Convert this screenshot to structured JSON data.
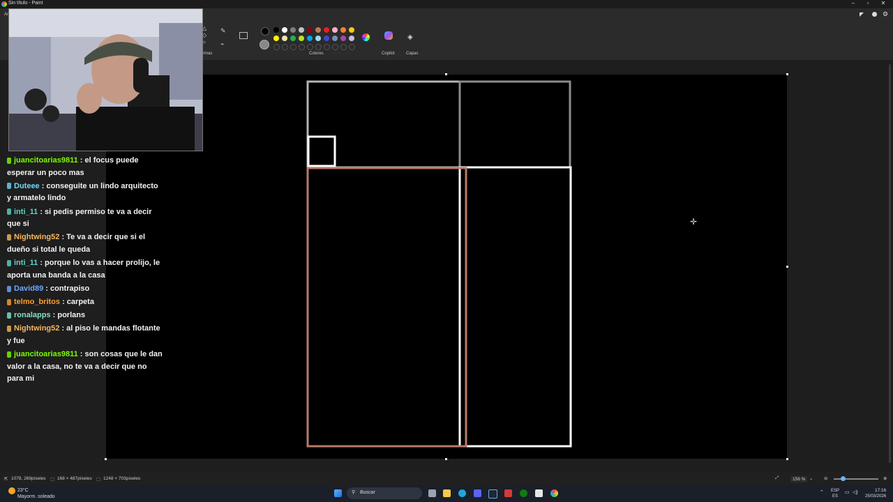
{
  "window": {
    "title": "Sin título - Paint"
  },
  "ribbon": {
    "groups": [
      "Formas",
      "Colores",
      "Copilot",
      "Capas"
    ],
    "left_cut_label": "Ar",
    "colors": [
      "#000000",
      "#ffffff",
      "#7f7f7f",
      "#c3c3c3",
      "#880015",
      "#b97a57",
      "#ed1c24",
      "#ffaec9",
      "#ff7f27",
      "#ffc90e",
      "#fff200",
      "#efe4b0",
      "#22b14c",
      "#b5e61d",
      "#00a2e8",
      "#99d9ea",
      "#3f48cc",
      "#7092be",
      "#a349a4",
      "#c8bfe7"
    ]
  },
  "chat": {
    "messages": [
      {
        "user": "juancitoarias9811",
        "user_color": "#7cfc00",
        "text": ": el focus puede esperar un poco mas"
      },
      {
        "user": "Duteee",
        "user_color": "#6fd6ff",
        "text": ": conseguite un lindo arquitecto y armatelo lindo"
      },
      {
        "user": "inti_11",
        "user_color": "#5fd3c6",
        "text": ": si pedis permiso te va a decir que si"
      },
      {
        "user": "Nightwing52",
        "user_color": "#f4b860",
        "text": ": Te va a decir que si el dueño si total le queda"
      },
      {
        "user": "inti_11",
        "user_color": "#5fd3c6",
        "text": ": porque lo vas a hacer prolijo, le aporta una banda a la casa"
      },
      {
        "user": "David89",
        "user_color": "#6fa8ff",
        "text": ": contrapiso"
      },
      {
        "user": "telmo_britos",
        "user_color": "#ff9f2f",
        "text": ": carpeta"
      },
      {
        "user": "ronalapps",
        "user_color": "#7fe3c8",
        "text": ": porlans"
      },
      {
        "user": "Nightwing52",
        "user_color": "#f4b860",
        "text": ": al piso le mandas flotante y fue"
      },
      {
        "user": "juancitoarias9811",
        "user_color": "#7cfc00",
        "text": ": son cosas que le dan valor a la casa, no te va a decir que no para mi"
      }
    ]
  },
  "statusbar": {
    "cursor_pos": "1078, 269píxeles",
    "selection_size": "168 × 487píxeles",
    "canvas_size": "1248 × 703píxeles",
    "zoom": "156 %"
  },
  "taskbar": {
    "weather_temp": "23°C",
    "weather_desc": "Mayorm. soleado",
    "search_placeholder": "Buscar",
    "lang_top": "ESP",
    "lang_bottom": "ES",
    "time": "17:16",
    "date": "25/03/2026"
  }
}
